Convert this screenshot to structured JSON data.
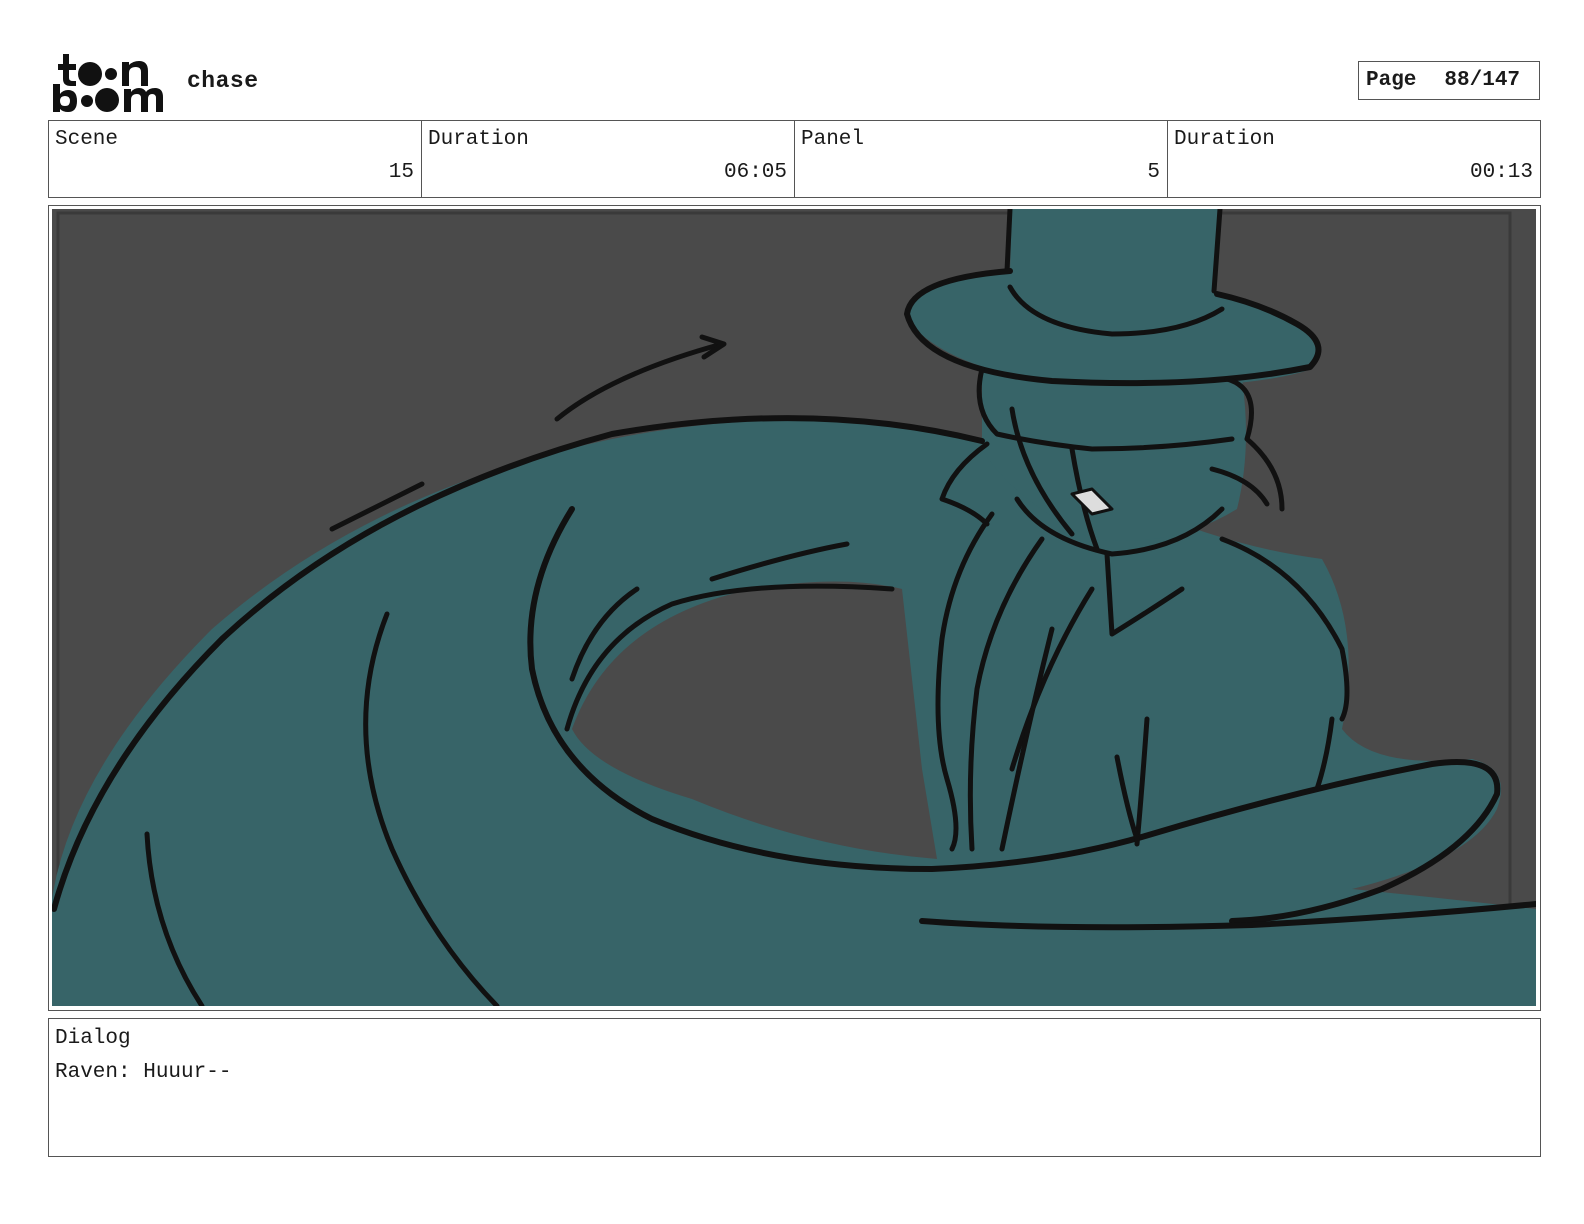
{
  "header": {
    "logo": {
      "icon": "toonboom-logo",
      "line1": "toon",
      "line2": "boom"
    },
    "project_title": "chase",
    "page": {
      "label": "Page",
      "value": "88/147"
    }
  },
  "info": {
    "scene": {
      "label": "Scene",
      "value": "15"
    },
    "scene_duration": {
      "label": "Duration",
      "value": "06:05"
    },
    "panel": {
      "label": "Panel",
      "value": "5"
    },
    "panel_duration": {
      "label": "Duration",
      "value": "00:13"
    }
  },
  "panel_image": {
    "icon": "storyboard-sketch",
    "colors": {
      "background": "#4a4a4a",
      "fill": "#376468",
      "line": "#111111"
    }
  },
  "dialog": {
    "label": "Dialog",
    "text": "Raven: Huuur--"
  }
}
